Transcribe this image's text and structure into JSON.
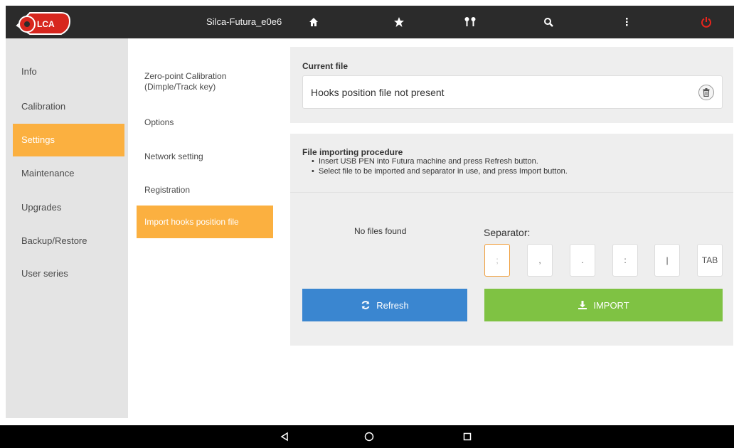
{
  "header": {
    "device_name": "Silca-Futura_e0e6",
    "logo": "silca-logo",
    "icons": [
      "home-icon",
      "star-icon",
      "keys-icon",
      "search-icon",
      "more-vertical-icon",
      "power-icon"
    ],
    "power_color": "#e8251d"
  },
  "sidebar": {
    "items": [
      {
        "label": "Info"
      },
      {
        "label": "Calibration"
      },
      {
        "label": "Settings"
      },
      {
        "label": "Maintenance"
      },
      {
        "label": "Upgrades"
      },
      {
        "label": "Backup/Restore"
      },
      {
        "label": "User series"
      }
    ],
    "active_index": 2
  },
  "submenu": {
    "items": [
      {
        "label": "Zero-point Calibration\n(Dimple/Track key)"
      },
      {
        "label": "Options"
      },
      {
        "label": "Network setting"
      },
      {
        "label": "Registration"
      },
      {
        "label": "Import hooks position file"
      }
    ],
    "active_index": 4
  },
  "current_file": {
    "heading": "Current file",
    "value": "Hooks position file not present",
    "delete_icon": "trash-icon"
  },
  "import": {
    "heading": "File importing procedure",
    "steps": [
      "Insert USB PEN into Futura machine and press Refresh button.",
      "Select file to be imported and separator in use, and press Import button."
    ],
    "no_files": "No files found",
    "separator_label": "Separator:",
    "separators": [
      ";",
      ",",
      ".",
      ":",
      "|",
      "TAB"
    ],
    "selected_separator": ";",
    "refresh_label": "Refresh",
    "import_label": "IMPORT"
  },
  "colors": {
    "accent": "#fbb040",
    "refresh": "#3a86d0",
    "import": "#7fc243"
  },
  "android_nav": [
    "back-icon",
    "home-circle-icon",
    "recents-icon"
  ]
}
